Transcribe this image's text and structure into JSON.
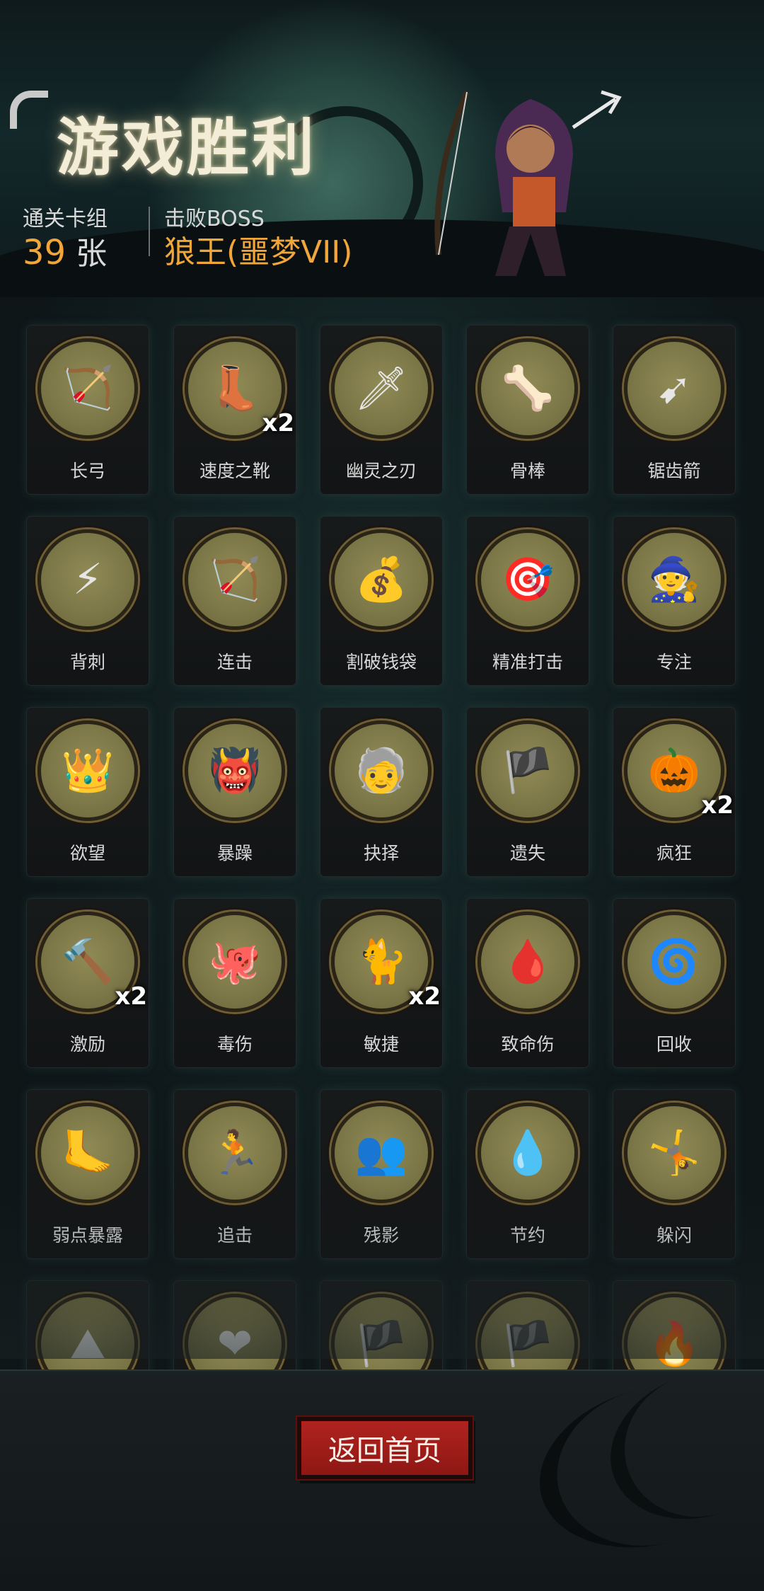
{
  "header": {
    "title": "游戏胜利",
    "deck_label": "通关卡组",
    "deck_count": "39",
    "deck_unit": "张",
    "boss_label": "击败BOSS",
    "boss_name": "狼王(噩梦VII)"
  },
  "cards": [
    {
      "name": "长弓",
      "icon": "longbow-icon",
      "glyph": "🏹",
      "badge": ""
    },
    {
      "name": "速度之靴",
      "icon": "boots-icon",
      "glyph": "👢",
      "badge": "x2"
    },
    {
      "name": "幽灵之刃",
      "icon": "ghost-blade-icon",
      "glyph": "🗡",
      "badge": ""
    },
    {
      "name": "骨棒",
      "icon": "bone-club-icon",
      "glyph": "🦴",
      "badge": ""
    },
    {
      "name": "锯齿箭",
      "icon": "serrated-arrow-icon",
      "glyph": "➹",
      "badge": ""
    },
    {
      "name": "背刺",
      "icon": "backstab-icon",
      "glyph": "⚡",
      "badge": ""
    },
    {
      "name": "连击",
      "icon": "combo-icon",
      "glyph": "🏹",
      "badge": ""
    },
    {
      "name": "割破钱袋",
      "icon": "cut-purse-icon",
      "glyph": "💰",
      "badge": ""
    },
    {
      "name": "精准打击",
      "icon": "target-icon",
      "glyph": "🎯",
      "badge": ""
    },
    {
      "name": "专注",
      "icon": "wizard-icon",
      "glyph": "🧙",
      "badge": ""
    },
    {
      "name": "欲望",
      "icon": "greed-icon",
      "glyph": "👑",
      "badge": ""
    },
    {
      "name": "暴躁",
      "icon": "rage-icon",
      "glyph": "👹",
      "badge": ""
    },
    {
      "name": "抉择",
      "icon": "elder-icon",
      "glyph": "🧓",
      "badge": ""
    },
    {
      "name": "遗失",
      "icon": "lost-icon",
      "glyph": "🏴",
      "badge": ""
    },
    {
      "name": "疯狂",
      "icon": "pumpkin-icon",
      "glyph": "🎃",
      "badge": "x2"
    },
    {
      "name": "激励",
      "icon": "hammer-icon",
      "glyph": "🔨",
      "badge": "x2"
    },
    {
      "name": "毒伤",
      "icon": "poison-icon",
      "glyph": "🐙",
      "badge": ""
    },
    {
      "name": "敏捷",
      "icon": "panther-icon",
      "glyph": "🐈",
      "badge": "x2"
    },
    {
      "name": "致命伤",
      "icon": "fatal-wound-icon",
      "glyph": "🩸",
      "badge": ""
    },
    {
      "name": "回收",
      "icon": "recycle-icon",
      "glyph": "🌀",
      "badge": ""
    },
    {
      "name": "弱点暴露",
      "icon": "weak-point-icon",
      "glyph": "🦶",
      "badge": ""
    },
    {
      "name": "追击",
      "icon": "pursuit-icon",
      "glyph": "🏃",
      "badge": ""
    },
    {
      "name": "残影",
      "icon": "afterimage-icon",
      "glyph": "👥",
      "badge": ""
    },
    {
      "name": "节约",
      "icon": "water-drop-icon",
      "glyph": "💧",
      "badge": ""
    },
    {
      "name": "躲闪",
      "icon": "dodge-icon",
      "glyph": "🤸",
      "badge": ""
    },
    {
      "name": "",
      "icon": "mountain-icon",
      "glyph": "⛰",
      "badge": ""
    },
    {
      "name": "",
      "icon": "heart-cross-icon",
      "glyph": "❤",
      "badge": ""
    },
    {
      "name": "",
      "icon": "pirate-icon",
      "glyph": "🏴",
      "badge": ""
    },
    {
      "name": "",
      "icon": "pirate-icon",
      "glyph": "🏴",
      "badge": ""
    },
    {
      "name": "",
      "icon": "flame-mask-icon",
      "glyph": "🔥",
      "badge": ""
    }
  ],
  "footer": {
    "home_button": "返回首页"
  },
  "colors": {
    "accent": "#f0a63a",
    "button": "#b0231f",
    "medal": "#8f8a55"
  }
}
